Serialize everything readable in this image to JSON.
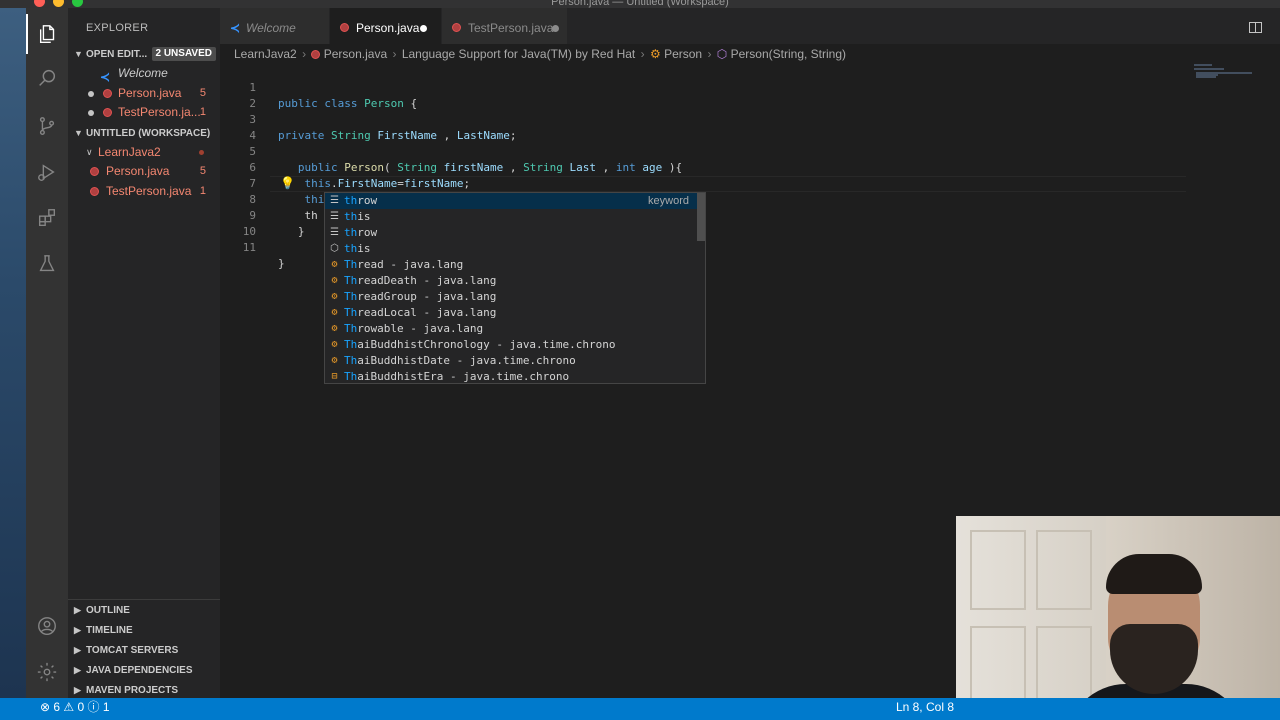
{
  "window": {
    "title": "Person.java — Untitled (Workspace)"
  },
  "colors": {
    "accent": "#007acc",
    "error": "#f48771",
    "keyword": "#569cd6",
    "type": "#4ec9b0"
  },
  "sidebar": {
    "header": "EXPLORER",
    "open_editors": {
      "label": "OPEN EDIT...",
      "badge": "2 UNSAVED",
      "items": [
        {
          "label": "Welcome",
          "icon": "vscode-icon"
        },
        {
          "label": "Person.java",
          "count": "5",
          "icon": "java-icon"
        },
        {
          "label": "TestPerson.ja...",
          "count": "1",
          "icon": "java-icon"
        }
      ]
    },
    "workspace": {
      "label": "UNTITLED (WORKSPACE)",
      "folder": "LearnJava2",
      "files": [
        {
          "label": "Person.java",
          "count": "5"
        },
        {
          "label": "TestPerson.java",
          "count": "1"
        }
      ]
    },
    "bottom_sections": [
      "OUTLINE",
      "TIMELINE",
      "TOMCAT SERVERS",
      "JAVA DEPENDENCIES",
      "MAVEN PROJECTS"
    ]
  },
  "tabs": [
    {
      "label": "Welcome",
      "icon": "vscode-icon"
    },
    {
      "label": "Person.java",
      "icon": "java-icon",
      "modified": true
    },
    {
      "label": "TestPerson.java",
      "icon": "java-icon",
      "modified": true
    }
  ],
  "breadcrumb": [
    "LearnJava2",
    "Person.java",
    "Language Support for Java(TM) by Red Hat",
    "Person",
    "Person(String, String)"
  ],
  "editor": {
    "lines": [
      "1",
      "2",
      "3",
      "4",
      "5",
      "6",
      "7",
      "8",
      "9",
      "10",
      "11"
    ],
    "typed_prefix": "th"
  },
  "suggestions": [
    {
      "label": "throw",
      "detail": "keyword",
      "icon": "snippet-icon"
    },
    {
      "label": "this",
      "detail": "",
      "icon": "snippet-icon"
    },
    {
      "label": "throw",
      "detail": "",
      "icon": "snippet-icon"
    },
    {
      "label": "this",
      "detail": "",
      "icon": "keyword-icon"
    },
    {
      "label": "Thread - java.lang",
      "detail": "",
      "icon": "class-icon"
    },
    {
      "label": "ThreadDeath - java.lang",
      "detail": "",
      "icon": "class-icon"
    },
    {
      "label": "ThreadGroup - java.lang",
      "detail": "",
      "icon": "class-icon"
    },
    {
      "label": "ThreadLocal - java.lang",
      "detail": "",
      "icon": "class-icon"
    },
    {
      "label": "Throwable - java.lang",
      "detail": "",
      "icon": "class-icon"
    },
    {
      "label": "ThaiBuddhistChronology - java.time.chrono",
      "detail": "",
      "icon": "class-icon"
    },
    {
      "label": "ThaiBuddhistDate - java.time.chrono",
      "detail": "",
      "icon": "class-icon"
    },
    {
      "label": "ThaiBuddhistEra - java.time.chrono",
      "detail": "",
      "icon": "enum-icon"
    }
  ],
  "statusbar": {
    "problems": "⊗ 6 ⚠ 0 ⓘ 1",
    "cursor": "Ln 8, Col 8"
  }
}
